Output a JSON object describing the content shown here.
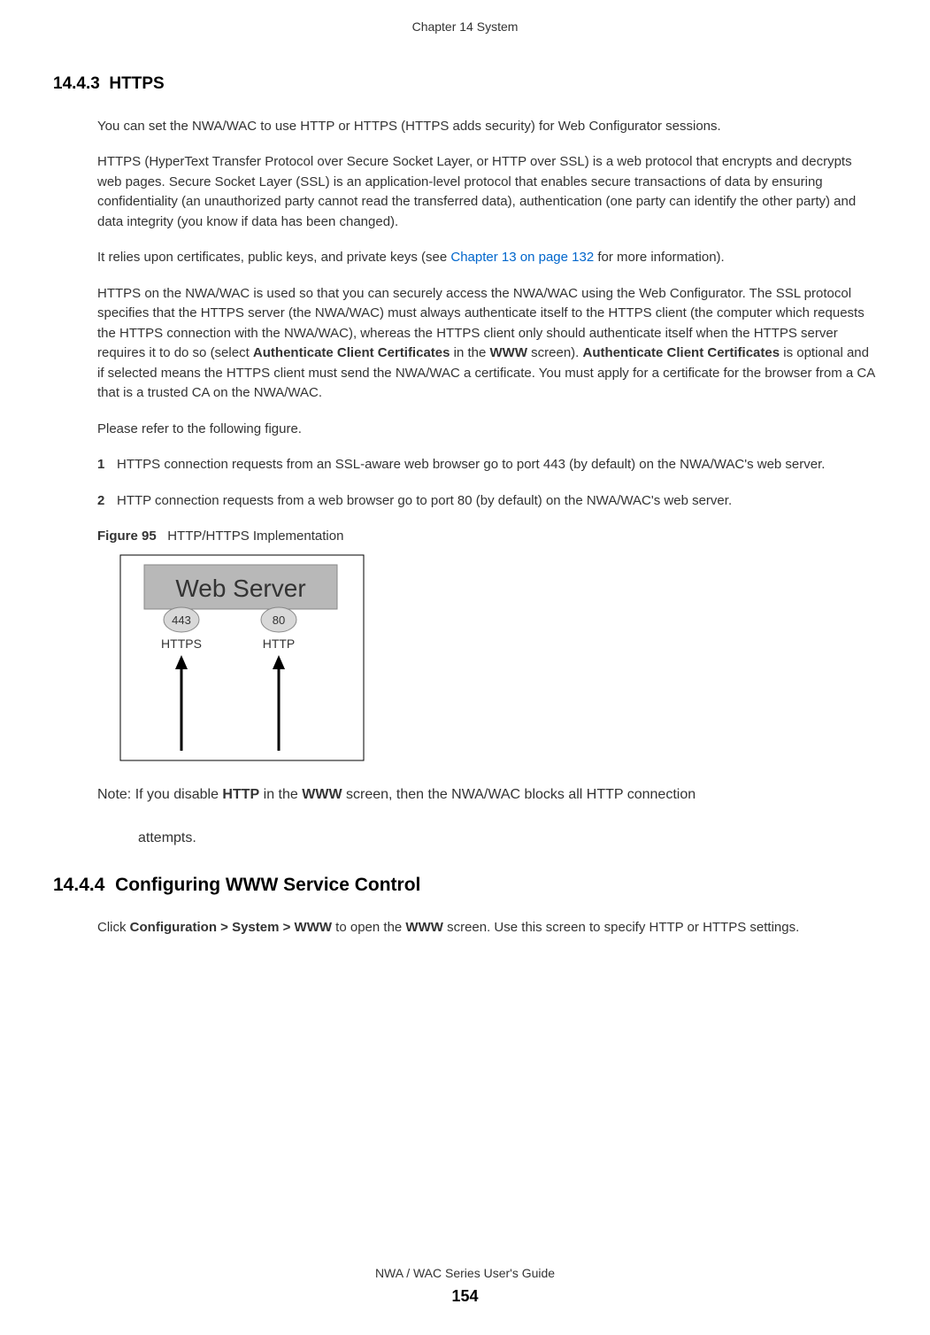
{
  "header": {
    "chapter": "Chapter 14 System"
  },
  "section1": {
    "number": "14.4.3",
    "title": "HTTPS"
  },
  "para1": "You can set the NWA/WAC to use HTTP or HTTPS (HTTPS adds security) for Web Configurator sessions.",
  "para2": "HTTPS (HyperText Transfer Protocol over Secure Socket Layer, or HTTP over SSL) is a web protocol that encrypts and decrypts web pages. Secure Socket Layer (SSL) is an application-level protocol that enables secure transactions of data by ensuring confidentiality (an unauthorized party cannot read the transferred data), authentication (one party can identify the other party) and data integrity (you know if data has been changed).",
  "para3_pre": "It relies upon certificates, public keys, and private keys (see ",
  "para3_link": "Chapter 13 on page 132",
  "para3_post": " for more information).",
  "para4_pre": "HTTPS on the NWA/WAC is used so that you can securely access the NWA/WAC using the Web Configurator. The SSL protocol specifies that the HTTPS server (the NWA/WAC) must always authenticate itself to the HTTPS client (the computer which requests the HTTPS connection with the NWA/WAC), whereas the HTTPS client only should authenticate itself when the HTTPS server requires it to do so (select ",
  "para4_bold1": "Authenticate Client Certificates",
  "para4_mid1": " in the ",
  "para4_bold2": "WWW",
  "para4_mid2": " screen). ",
  "para4_bold3": "Authenticate Client Certificates",
  "para4_post": " is optional and if selected means the HTTPS client must send the NWA/WAC a certificate. You must apply for a certificate for the browser from a CA that is a trusted CA on the NWA/WAC.",
  "para5": "Please refer to the following figure.",
  "list": [
    {
      "num": "1",
      "text": "HTTPS connection requests from an SSL-aware web browser go to port 443 (by default) on the NWA/WAC's web server."
    },
    {
      "num": "2",
      "text": "HTTP connection requests from a web browser go to port 80 (by default) on the NWA/WAC's web server."
    }
  ],
  "figure": {
    "label": "Figure 95",
    "title": "HTTP/HTTPS Implementation",
    "web_server": "Web Server",
    "port_443": "443",
    "port_80": "80",
    "https": "HTTPS",
    "http": "HTTP"
  },
  "note_pre": "Note: If you disable ",
  "note_bold1": "HTTP",
  "note_mid1": " in the ",
  "note_bold2": "WWW",
  "note_post": " screen, then the NWA/WAC blocks all HTTP connection",
  "note_line2": "attempts.",
  "section2": {
    "number": "14.4.4",
    "title": "Configuring WWW Service Control"
  },
  "para6_pre": "Click ",
  "para6_bold1": "Configuration > System > WWW",
  "para6_mid1": " to open the ",
  "para6_bold2": "WWW",
  "para6_post": " screen. Use this screen to specify HTTP or HTTPS settings.",
  "footer": {
    "guide": "NWA / WAC Series User's Guide",
    "page": "154"
  }
}
